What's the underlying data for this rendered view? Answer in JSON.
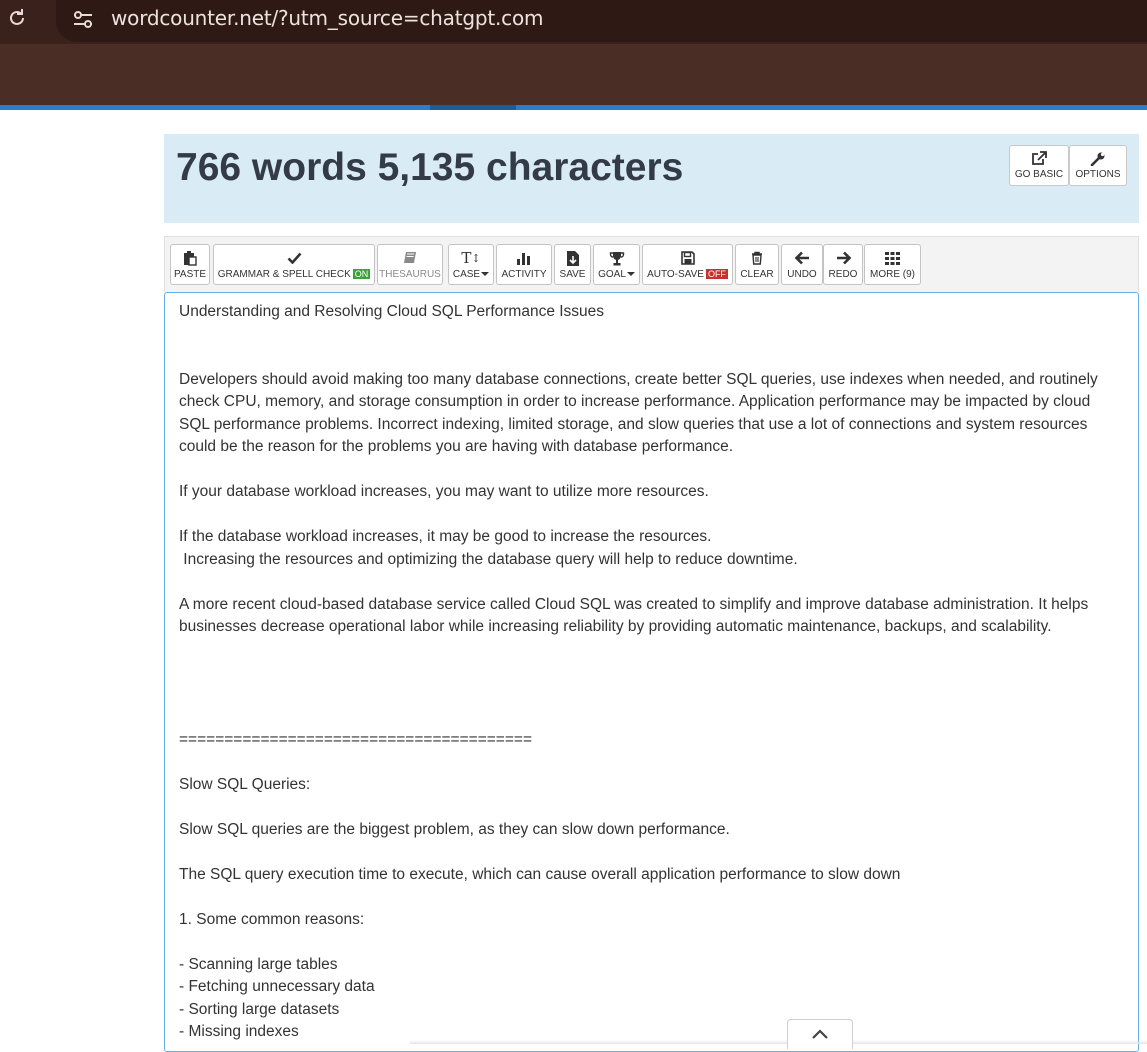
{
  "browser": {
    "url": "wordcounter.net/?utm_source=chatgpt.com"
  },
  "header": {
    "count_title": "766 words 5,135 characters",
    "go_basic_label": "GO BASIC",
    "options_label": "OPTIONS"
  },
  "toolbar": {
    "paste": "PASTE",
    "grammar": "GRAMMAR & SPELL CHECK",
    "grammar_state": "ON",
    "thesaurus": "THESAURUS",
    "case": "CASE",
    "activity": "ACTIVITY",
    "save": "SAVE",
    "goal": "GOAL",
    "autosave": "AUTO-SAVE",
    "autosave_state": "OFF",
    "clear": "CLEAR",
    "undo": "UNDO",
    "redo": "REDO",
    "more": "MORE (9)"
  },
  "editor": {
    "lines": [
      "Understanding and Resolving Cloud SQL Performance Issues",
      "Developers should avoid making too many database connections, create better SQL queries, use indexes when needed, and routinely",
      "check CPU, memory, and storage consumption in order to increase performance. Application performance may be impacted by cloud",
      "SQL performance problems. Incorrect indexing, limited storage, and slow queries that use a lot of connections and system resources",
      "could be the reason for the problems you are having with database performance.",
      "If your database workload increases, you may want to utilize more resources.",
      "If the database workload increases, it may be good to increase the resources.",
      " Increasing the resources and optimizing the database query will help to reduce downtime.",
      "A more recent cloud-based database service called Cloud SQL was created to simplify and improve database administration. It helps",
      "businesses decrease operational labor while increasing reliability by providing automatic maintenance, backups, and scalability.",
      "=======================================",
      "Slow SQL Queries:",
      "Slow SQL queries are the biggest problem, as they can slow down performance.",
      "The SQL query execution time to execute, which can cause overall application performance to slow down",
      "1. Some common reasons:",
      "- Scanning large tables",
      "- Fetching unnecessary data",
      "- Sorting large datasets",
      "- Missing indexes"
    ]
  }
}
